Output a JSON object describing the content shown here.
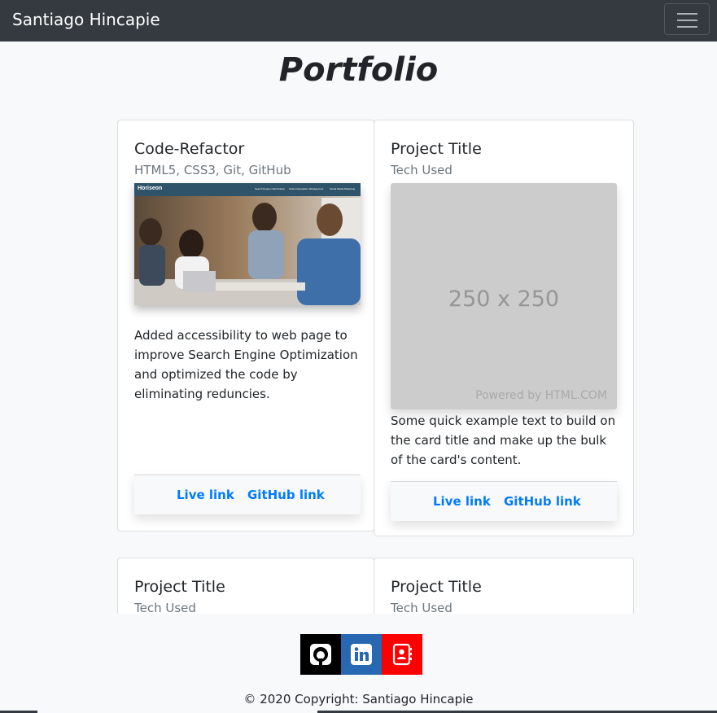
{
  "navbar": {
    "brand": "Santiago Hincapie",
    "menu_icon": "hamburger-menu-icon"
  },
  "page": {
    "title": "Portfolio"
  },
  "cards": [
    {
      "title": "Code-Refactor",
      "tech": "HTML5, CSS3, Git, GitHub",
      "image": {
        "logo": "Horiseon",
        "nav": [
          "Search Engine Optimization",
          "Online Reputation Management",
          "Social Media Marketing"
        ]
      },
      "text": "Added accessibility to web page to improve Search Engine Optimization and optimized the code by eliminating reduncies.",
      "live_link": "Live link",
      "github_link": "GitHub link"
    },
    {
      "title": "Project Title",
      "tech": "Tech Used",
      "placeholder": {
        "label": "250 x 250",
        "powered": "Powered by HTML.COM"
      },
      "text": "Some quick example text to build on the card title and make up the bulk of the card's content.",
      "live_link": "Live link",
      "github_link": "GitHub link"
    },
    {
      "title": "Project Title",
      "tech": "Tech Used"
    },
    {
      "title": "Project Title",
      "tech": "Tech Used"
    }
  ],
  "footer": {
    "social": [
      {
        "name": "github",
        "icon": "github-icon",
        "color": "#000000"
      },
      {
        "name": "linkedin",
        "icon": "linkedin-icon",
        "color": "#2867b2"
      },
      {
        "name": "contact",
        "icon": "contact-book-icon",
        "color": "#ff0000"
      }
    ],
    "copyright": "© 2020 Copyright: Santiago Hincapie"
  },
  "colors": {
    "navbar": "#343a40",
    "link": "#007bff",
    "background": "#f8f9fa"
  }
}
